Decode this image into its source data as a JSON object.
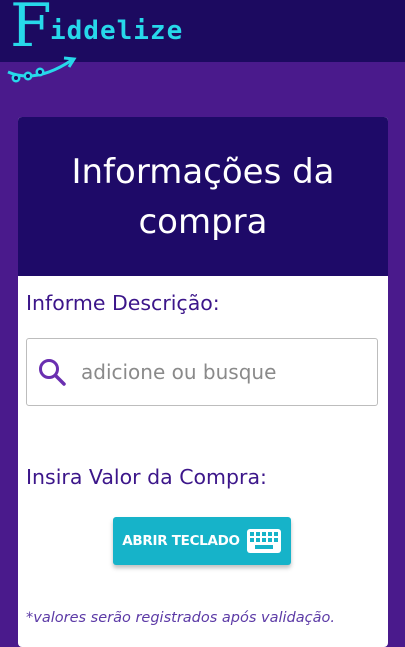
{
  "brand": {
    "logo_initial": "F",
    "logo_rest": "iddelize",
    "logo_color": "#27d8ea"
  },
  "colors": {
    "page_background": "#4a1a8c",
    "topbar_background": "#1c0a60",
    "card_header_background": "#1e0a68",
    "label_color": "#3c168a",
    "button_background": "#16b3c9"
  },
  "card": {
    "title": "Informações da compra"
  },
  "form": {
    "description_label": "Informe Descrição:",
    "search": {
      "placeholder": "adicione ou busque",
      "value": "",
      "icon": "search-icon"
    },
    "value_label": "Insira Valor da Compra:",
    "keyboard_button": {
      "label": "ABRIR TECLADO",
      "icon": "keyboard-icon"
    },
    "note": "*valores serão registrados após validação."
  }
}
